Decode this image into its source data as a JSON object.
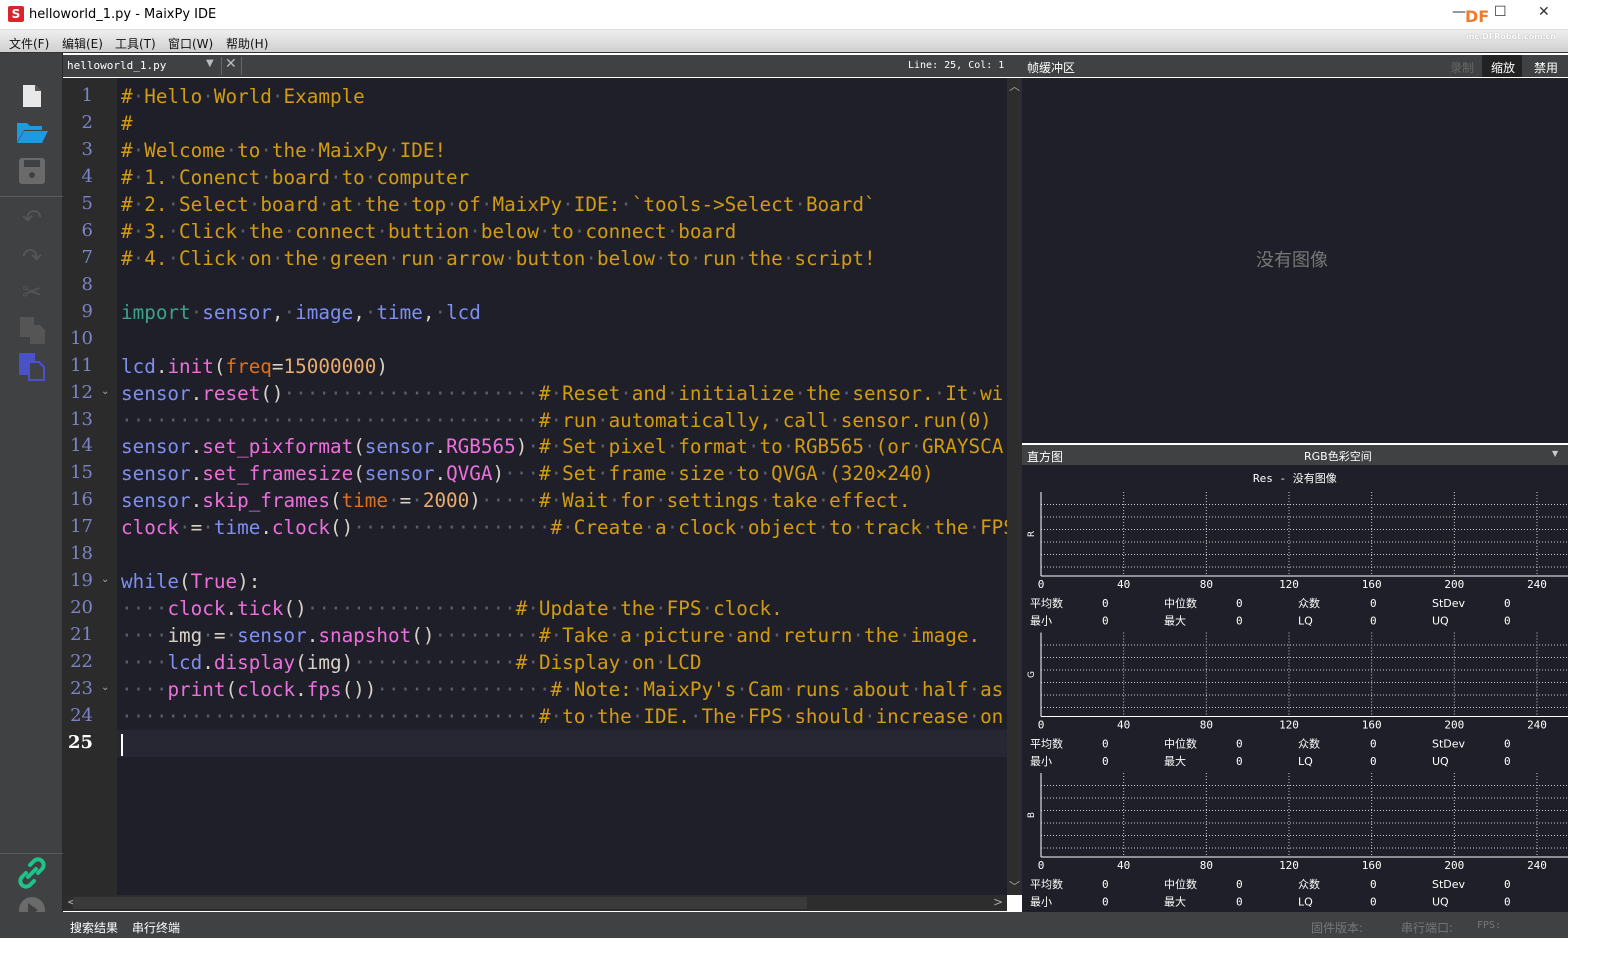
{
  "window": {
    "title": "helloworld_1.py - MaixPy IDE",
    "logo": "S",
    "brand": "DF",
    "watermark": "mc.DFRobot.com.cn",
    "minimize": "—",
    "maximize": "☐",
    "close": "✕"
  },
  "menu": [
    "文件(F)",
    "编辑(E)",
    "工具(T)",
    "窗口(W)",
    "帮助(H)"
  ],
  "toolbar": {
    "icons": [
      "new-file-icon",
      "open-folder-icon",
      "save-icon",
      "undo-icon",
      "redo-icon",
      "cut-icon",
      "copy-icon",
      "paste-icon",
      "connect-icon",
      "run-icon"
    ]
  },
  "editor": {
    "tab": "helloworld_1.py",
    "position": "Line: 25, Col: 1",
    "current_line": 25,
    "lines": [
      [
        [
          "c",
          "# Hello World Example"
        ]
      ],
      [
        [
          "c",
          "#"
        ]
      ],
      [
        [
          "c",
          "# Welcome to the MaixPy IDE!"
        ]
      ],
      [
        [
          "c",
          "# 1. Conenct board to computer"
        ]
      ],
      [
        [
          "c",
          "# 2. Select board at the top of MaixPy IDE: `tools->Select Board`"
        ]
      ],
      [
        [
          "c",
          "# 3. Click the connect buttion below to connect board"
        ]
      ],
      [
        [
          "c",
          "# 4. Click on the green run arrow button below to run the script!"
        ]
      ],
      [],
      [
        [
          "k",
          "import"
        ],
        [
          "w",
          " "
        ],
        [
          "i",
          "sensor"
        ],
        [
          "o",
          ", "
        ],
        [
          "i",
          "image"
        ],
        [
          "o",
          ", "
        ],
        [
          "i",
          "time"
        ],
        [
          "o",
          ", "
        ],
        [
          "i",
          "lcd"
        ]
      ],
      [],
      [
        [
          "i",
          "lcd"
        ],
        [
          "o",
          "."
        ],
        [
          "f",
          "init"
        ],
        [
          "o",
          "("
        ],
        [
          "p",
          "freq"
        ],
        [
          "o",
          "="
        ],
        [
          "n",
          "15000000"
        ],
        [
          "o",
          ")"
        ]
      ],
      [
        [
          "i",
          "sensor"
        ],
        [
          "o",
          "."
        ],
        [
          "f",
          "reset"
        ],
        [
          "o",
          "()"
        ],
        [
          "w",
          "                      "
        ],
        [
          "c",
          "# Reset and initialize the sensor. It wi"
        ]
      ],
      [
        [
          "w",
          "                                    "
        ],
        [
          "c",
          "# run automatically, call sensor.run(0)"
        ]
      ],
      [
        [
          "i",
          "sensor"
        ],
        [
          "o",
          "."
        ],
        [
          "f",
          "set_pixformat"
        ],
        [
          "o",
          "("
        ],
        [
          "i",
          "sensor"
        ],
        [
          "o",
          "."
        ],
        [
          "f",
          "RGB565"
        ],
        [
          "o",
          ")"
        ],
        [
          "w",
          " "
        ],
        [
          "c",
          "# Set pixel format to RGB565 (or GRAYSCA"
        ]
      ],
      [
        [
          "i",
          "sensor"
        ],
        [
          "o",
          "."
        ],
        [
          "f",
          "set_framesize"
        ],
        [
          "o",
          "("
        ],
        [
          "i",
          "sensor"
        ],
        [
          "o",
          "."
        ],
        [
          "f",
          "QVGA"
        ],
        [
          "o",
          ")"
        ],
        [
          "w",
          "   "
        ],
        [
          "c",
          "# Set frame size to QVGA (320×240)"
        ]
      ],
      [
        [
          "i",
          "sensor"
        ],
        [
          "o",
          "."
        ],
        [
          "f",
          "skip_frames"
        ],
        [
          "o",
          "("
        ],
        [
          "p",
          "time"
        ],
        [
          "w",
          " "
        ],
        [
          "o",
          "="
        ],
        [
          "w",
          " "
        ],
        [
          "n",
          "2000"
        ],
        [
          "o",
          ")"
        ],
        [
          "w",
          "     "
        ],
        [
          "c",
          "# Wait for settings take effect."
        ]
      ],
      [
        [
          "f",
          "clock"
        ],
        [
          "w",
          " "
        ],
        [
          "o",
          "="
        ],
        [
          "w",
          " "
        ],
        [
          "i",
          "time"
        ],
        [
          "o",
          "."
        ],
        [
          "f",
          "clock"
        ],
        [
          "o",
          "()"
        ],
        [
          "w",
          "                 "
        ],
        [
          "c",
          "# Create a clock object to track the FPS"
        ]
      ],
      [],
      [
        [
          "i",
          "while"
        ],
        [
          "o",
          "("
        ],
        [
          "f",
          "True"
        ],
        [
          "o",
          "):"
        ]
      ],
      [
        [
          "w",
          "    "
        ],
        [
          "f",
          "clock"
        ],
        [
          "o",
          "."
        ],
        [
          "f",
          "tick"
        ],
        [
          "o",
          "()"
        ],
        [
          "w",
          "                  "
        ],
        [
          "c",
          "# Update the FPS clock."
        ]
      ],
      [
        [
          "w",
          "    "
        ],
        [
          "v",
          "img"
        ],
        [
          "w",
          " "
        ],
        [
          "o",
          "="
        ],
        [
          "w",
          " "
        ],
        [
          "i",
          "sensor"
        ],
        [
          "o",
          "."
        ],
        [
          "f",
          "snapshot"
        ],
        [
          "o",
          "()"
        ],
        [
          "w",
          "         "
        ],
        [
          "c",
          "# Take a picture and return the image."
        ]
      ],
      [
        [
          "w",
          "    "
        ],
        [
          "i",
          "lcd"
        ],
        [
          "o",
          "."
        ],
        [
          "f",
          "display"
        ],
        [
          "o",
          "(img)"
        ],
        [
          "w",
          "              "
        ],
        [
          "c",
          "# Display on LCD"
        ]
      ],
      [
        [
          "w",
          "    "
        ],
        [
          "f",
          "print"
        ],
        [
          "o",
          "("
        ],
        [
          "f",
          "clock"
        ],
        [
          "o",
          "."
        ],
        [
          "f",
          "fps"
        ],
        [
          "o",
          "())"
        ],
        [
          "w",
          "               "
        ],
        [
          "c",
          "# Note: MaixPy's Cam runs about half as"
        ]
      ],
      [
        [
          "w",
          "                                    "
        ],
        [
          "c",
          "# to the IDE. The FPS should increase on"
        ]
      ],
      []
    ],
    "fold_lines": [
      12,
      19,
      23
    ]
  },
  "framebuffer": {
    "title": "帧缓冲区",
    "record": "录制",
    "zoom": "缩放",
    "disable": "禁用",
    "empty": "没有图像"
  },
  "histogram": {
    "title": "直方图",
    "colorspace": "RGB色彩空间",
    "subtitle": "Res - 没有图像",
    "channels": [
      {
        "name": "R"
      },
      {
        "name": "G"
      },
      {
        "name": "B"
      }
    ],
    "x_ticks": [
      0,
      40,
      80,
      120,
      160,
      200,
      240
    ],
    "xlim": [
      0,
      255
    ],
    "stats": {
      "mean_label": "平均数",
      "mean": "0",
      "median_label": "中位数",
      "median": "0",
      "mode_label": "众数",
      "mode": "0",
      "stdev_label": "StDev",
      "stdev": "0",
      "min_label": "最小",
      "min": "0",
      "max_label": "最大",
      "max": "0",
      "lq_label": "LQ",
      "lq": "0",
      "uq_label": "UQ",
      "uq": "0"
    }
  },
  "bottom": {
    "search_results": "搜索结果",
    "serial_terminal": "串行终端",
    "firmware": "固件版本:",
    "serial_port": "串行端口:",
    "fps": "FPS:"
  },
  "colors": {
    "editor_bg": "#1e1f28",
    "comment": "#d39b12",
    "accent_connect": "#1fc28a",
    "open_icon": "#1e9be0",
    "paste_icon": "#4a52c8"
  }
}
